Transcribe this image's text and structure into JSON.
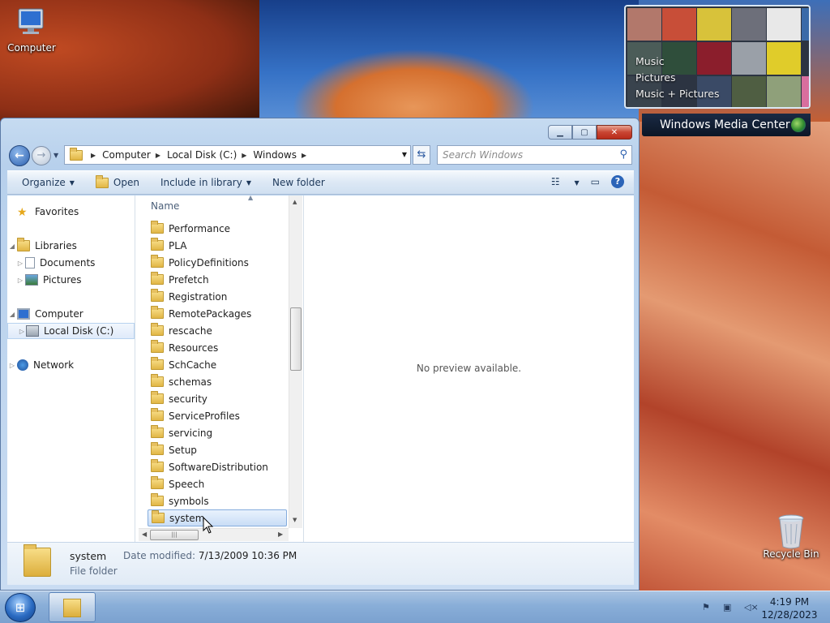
{
  "desktop": {
    "computer_label": "Computer",
    "recycle_label": "Recycle Bin"
  },
  "wmc": {
    "menu": [
      "Music",
      "Pictures",
      "Music + Pictures"
    ],
    "brand_bold": "Windows",
    "brand_rest": " Media Center"
  },
  "window": {
    "address": [
      "Computer",
      "Local Disk (C:)",
      "Windows"
    ],
    "search_placeholder": "Search Windows",
    "toolbar": {
      "organize": "Organize",
      "open": "Open",
      "include": "Include in library",
      "new_folder": "New folder"
    },
    "nav": {
      "favorites": "Favorites",
      "libraries": "Libraries",
      "documents": "Documents",
      "pictures": "Pictures",
      "computer": "Computer",
      "local_disk": "Local Disk (C:)",
      "network": "Network"
    },
    "column_name": "Name",
    "files": [
      "Performance",
      "PLA",
      "PolicyDefinitions",
      "Prefetch",
      "Registration",
      "RemotePackages",
      "rescache",
      "Resources",
      "SchCache",
      "schemas",
      "security",
      "ServiceProfiles",
      "servicing",
      "Setup",
      "SoftwareDistribution",
      "Speech",
      "symbols",
      "system"
    ],
    "selected_file": "system",
    "preview_msg": "No preview available.",
    "details": {
      "name": "system",
      "modified_label": "Date modified:",
      "modified_value": "7/13/2009 10:36 PM",
      "type": "File folder"
    }
  },
  "taskbar": {
    "time": "4:19 PM",
    "date": "12/28/2023"
  },
  "colors": {
    "selection_border": "#84acdd",
    "close_button": "#c94532",
    "taskbar": "#89aed8"
  }
}
